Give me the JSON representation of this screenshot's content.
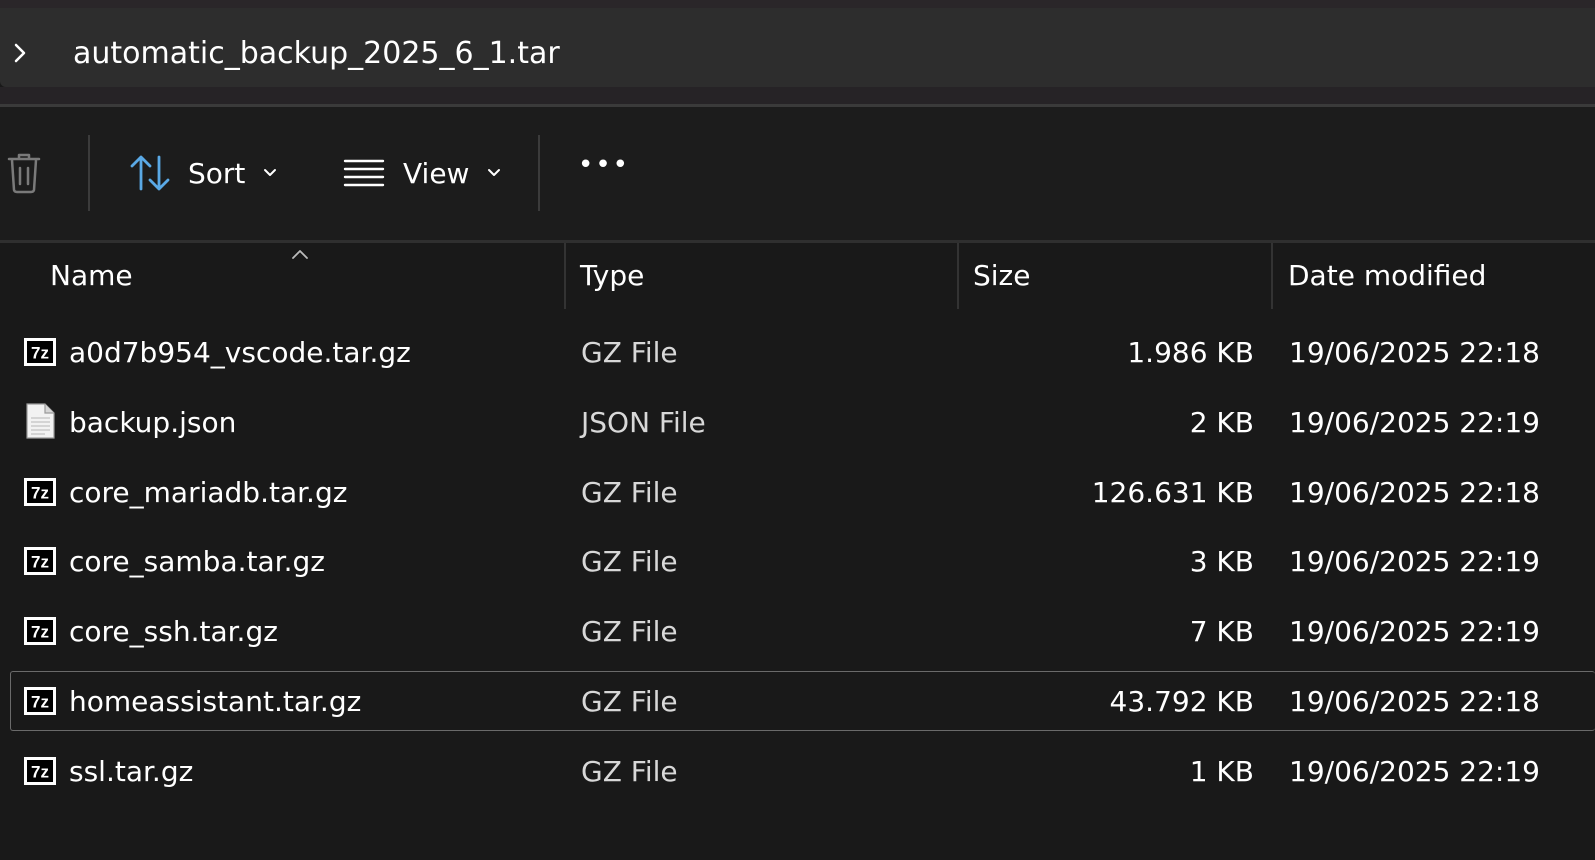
{
  "address": {
    "path": "automatic_backup_2025_6_1.tar"
  },
  "toolbar": {
    "sort_label": "Sort",
    "view_label": "View",
    "more_label": "•••"
  },
  "columns": {
    "name": "Name",
    "type": "Type",
    "size": "Size",
    "date": "Date modified"
  },
  "files": [
    {
      "name": "a0d7b954_vscode.tar.gz",
      "type": "GZ File",
      "size": "1.986 KB",
      "date": "19/06/2025 22:18",
      "icon": "7z-archive-icon"
    },
    {
      "name": "backup.json",
      "type": "JSON File",
      "size": "2 KB",
      "date": "19/06/2025 22:19",
      "icon": "document-icon"
    },
    {
      "name": "core_mariadb.tar.gz",
      "type": "GZ File",
      "size": "126.631 KB",
      "date": "19/06/2025 22:18",
      "icon": "7z-archive-icon"
    },
    {
      "name": "core_samba.tar.gz",
      "type": "GZ File",
      "size": "3 KB",
      "date": "19/06/2025 22:19",
      "icon": "7z-archive-icon"
    },
    {
      "name": "core_ssh.tar.gz",
      "type": "GZ File",
      "size": "7 KB",
      "date": "19/06/2025 22:19",
      "icon": "7z-archive-icon"
    },
    {
      "name": "homeassistant.tar.gz",
      "type": "GZ File",
      "size": "43.792 KB",
      "date": "19/06/2025 22:18",
      "icon": "7z-archive-icon"
    },
    {
      "name": "ssl.tar.gz",
      "type": "GZ File",
      "size": "1 KB",
      "date": "19/06/2025 22:19",
      "icon": "7z-archive-icon"
    }
  ],
  "selected_index": 5,
  "icon_text": "7z",
  "colors": {
    "background": "#191919",
    "address_bar": "#2d2d2d",
    "text": "#ffffff",
    "selection_border": "#6a6a6a"
  }
}
